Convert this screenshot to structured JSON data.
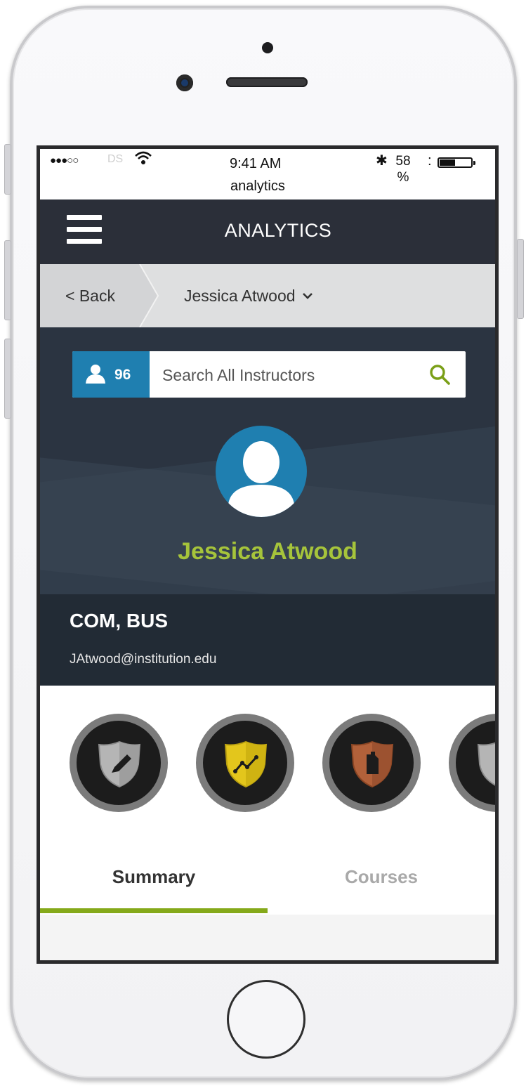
{
  "status_bar": {
    "signal": "●●●○○",
    "carrier": "DS",
    "time": "9:41 AM",
    "subtitle": "analytics",
    "bluetooth": "✱",
    "battery_pct": "58\n%",
    "colon": ":"
  },
  "navbar": {
    "title": "ANALYTICS",
    "menu_icon": "hamburger-icon"
  },
  "breadcrumb": {
    "back_label": "< Back",
    "current_label": "Jessica Atwood",
    "dropdown_icon": "chevron-down-icon"
  },
  "search": {
    "count": "96",
    "placeholder": "Search All Instructors",
    "icon": "search-icon"
  },
  "profile": {
    "name": "Jessica Atwood",
    "department": "COM, BUS",
    "email": "JAtwood@institution.edu",
    "avatar_icon": "user-avatar-icon"
  },
  "badges": [
    {
      "name": "pencil-shield-badge",
      "color": "#b5b5b5"
    },
    {
      "name": "trend-shield-badge",
      "color": "#e3c61c"
    },
    {
      "name": "document-shield-badge",
      "color": "#b2613a"
    },
    {
      "name": "silver-shield-badge",
      "color": "#b5b5b5"
    }
  ],
  "tabs": [
    {
      "label": "Summary",
      "active": true
    },
    {
      "label": "Courses",
      "active": false
    }
  ],
  "colors": {
    "navbar_bg": "#2b2f39",
    "accent_green": "#a6c43b",
    "accent_blue": "#1f7fb0",
    "tab_underline": "#85a91a"
  }
}
